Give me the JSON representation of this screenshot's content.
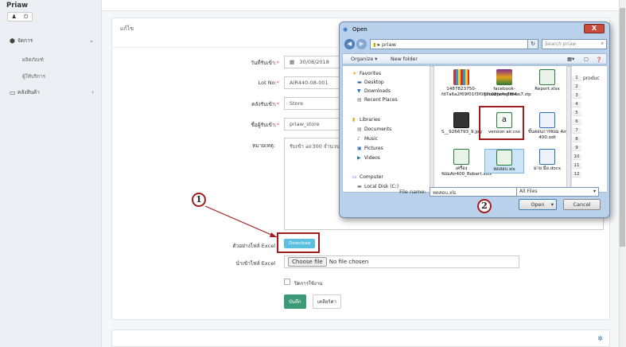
{
  "app": {
    "brand": "Priaw"
  },
  "sidebar": {
    "user_icons": [
      "user-icon",
      "power-icon"
    ],
    "items": [
      {
        "label": "จัดการ",
        "icon": "cube-icon",
        "chevron": "⌄"
      },
      {
        "label": "ผลิตภัณฑ์"
      },
      {
        "label": "ผู้ให้บริการ"
      },
      {
        "label": "คลังสินค้า",
        "icon": "inbox-icon",
        "chevron": "›"
      }
    ]
  },
  "form": {
    "panel_title": "แก้ไข",
    "date_label": "วันที่รับเข้า:",
    "date_value": "30/08/2018",
    "lot_label": "Lot No:",
    "lot_value": "AIR440-08-001",
    "store_label": "คลังรับเข้า:",
    "store_value": "Store",
    "receiver_label": "ชื่อผู้รับเข้า:",
    "receiver_value": "priaw_store",
    "note_label": "หมายเหตุ:",
    "note_value": "รับเข้า air300 จำนวน",
    "required_mark": "*",
    "excel_sample_label": "ตัวอย่างไฟล์ Excel",
    "download_label": "Download",
    "import_label": "นำเข้าไฟล์ Excel",
    "choose_file_label": "Choose file",
    "no_file_label": "No file chosen",
    "close_label": "ปิดการใช้งาน",
    "save_label": "บันทึก",
    "clear_label": "เคลียร์ค่า"
  },
  "annotations": {
    "one": "1",
    "two": "2",
    "color": "#a21d1d"
  },
  "dialog": {
    "title": "Open",
    "close": "X",
    "path_label": "priaw",
    "search_placeholder": "Search priaw",
    "toolbar": {
      "organize": "Organize ▾",
      "new_folder": "New folder"
    },
    "nav": {
      "favorites": "Favorites",
      "desktop": "Desktop",
      "downloads": "Downloads",
      "recent": "Recent Places",
      "libraries": "Libraries",
      "documents": "Documents",
      "music": "Music",
      "pictures": "Pictures",
      "videos": "Videos",
      "computer": "Computer",
      "local_disk": "Local Disk (C:)"
    },
    "files": [
      {
        "name": "1487823750-fd7a6a2f69f01f3f087c08fe4e7f84...",
        "icon": "image-icon"
      },
      {
        "name": "facebook-priawpompimon7.zip",
        "icon": "zip-icon"
      },
      {
        "name": "Report.xlsx",
        "icon": "excel-icon"
      },
      {
        "name": "S__9266793_9.jpg",
        "icon": "image-icon"
      },
      {
        "name": "version air.csv",
        "icon": "csv-icon"
      },
      {
        "name": "ขั้นตอนการซ่อม Air 400.odt",
        "icon": "word-icon"
      },
      {
        "name": "เครื่องซ่อมAir400_Robert.xlsx",
        "icon": "excel-icon"
      },
      {
        "name": "ทดสอบ.xls",
        "icon": "excel-icon"
      },
      {
        "name": "ม่าย มือ.docx",
        "icon": "word-icon"
      }
    ],
    "excel_rows": [
      "1",
      "2",
      "3",
      "4",
      "5",
      "6",
      "7",
      "8",
      "9",
      "10",
      "11",
      "12"
    ],
    "excel_cell": "produc",
    "filename_label": "File name:",
    "filename_value": "ทดสอบ.xls",
    "filter_value": "All Files",
    "open_label": "Open",
    "cancel_label": "Cancel"
  }
}
